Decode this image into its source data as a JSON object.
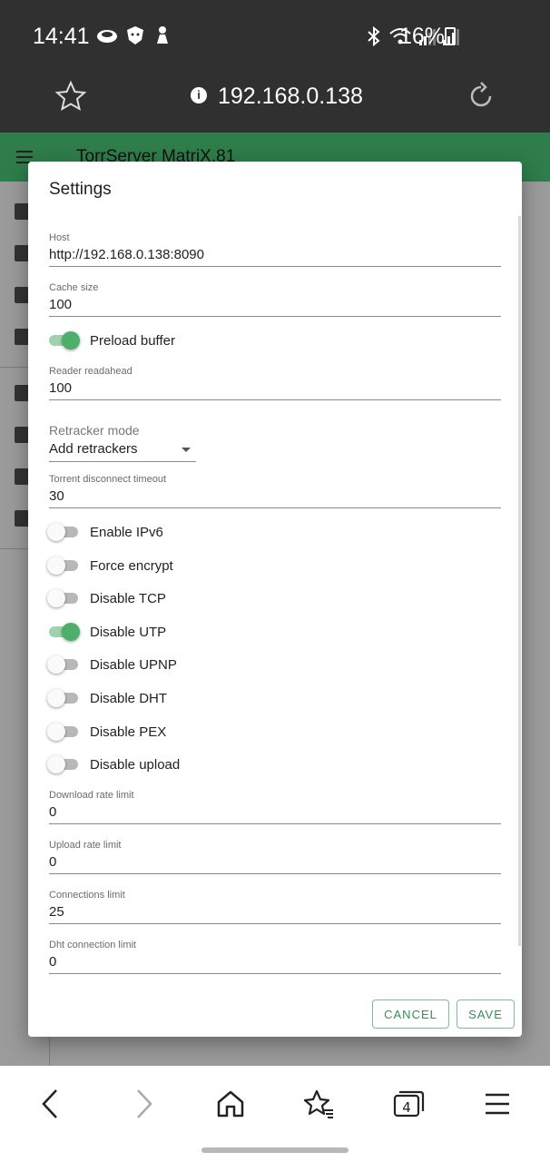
{
  "status_bar": {
    "time": "14:41",
    "battery": "16%",
    "left_icons": [
      "cloud-icon",
      "shield-face-icon",
      "figure-icon"
    ],
    "right_icons": [
      "bluetooth-icon",
      "wifi-icon",
      "signal-icon",
      "signal-icon",
      "battery-icon"
    ]
  },
  "browser": {
    "url": "192.168.0.138",
    "tab_count": "4"
  },
  "app": {
    "title": "TorrServer MatriX.81",
    "accent_color": "#2e7d4a"
  },
  "dialog": {
    "title": "Settings",
    "fields": {
      "host": {
        "label": "Host",
        "value": "http://192.168.0.138:8090"
      },
      "cache_size": {
        "label": "Cache size",
        "value": "100"
      },
      "reader_readahead": {
        "label": "Reader readahead",
        "value": "100"
      },
      "torrent_disconnect_timeout": {
        "label": "Torrent disconnect timeout",
        "value": "30"
      },
      "download_rate_limit": {
        "label": "Download rate limit",
        "value": "0"
      },
      "upload_rate_limit": {
        "label": "Upload rate limit",
        "value": "0"
      },
      "connections_limit": {
        "label": "Connections limit",
        "value": "25"
      },
      "dht_connection_limit": {
        "label": "Dht connection limit",
        "value": "0"
      }
    },
    "preload_buffer": {
      "label": "Preload buffer",
      "on": true
    },
    "retracker_mode": {
      "label": "Retracker mode",
      "selected": "Add retrackers"
    },
    "toggles": [
      {
        "label": "Enable IPv6",
        "on": false
      },
      {
        "label": "Force encrypt",
        "on": false
      },
      {
        "label": "Disable TCP",
        "on": false
      },
      {
        "label": "Disable UTP",
        "on": true
      },
      {
        "label": "Disable UPNP",
        "on": false
      },
      {
        "label": "Disable DHT",
        "on": false
      },
      {
        "label": "Disable PEX",
        "on": false
      },
      {
        "label": "Disable upload",
        "on": false
      }
    ],
    "cancel_label": "CANCEL",
    "save_label": "SAVE"
  }
}
